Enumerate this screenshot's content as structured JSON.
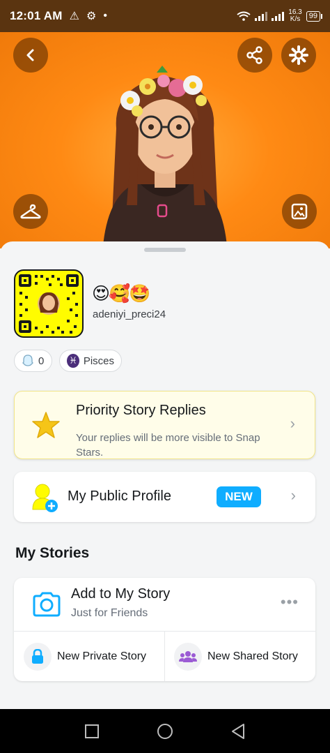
{
  "status_bar": {
    "time": "12:01 AM",
    "speed_value": "16.3",
    "speed_unit": "K/s",
    "battery": "99"
  },
  "hero": {
    "bg_color": "#ff8a14"
  },
  "profile": {
    "emojis": "😍🥰🤩",
    "username": "adeniyi_preci24",
    "friends_count": "0",
    "zodiac": "Pisces"
  },
  "priority_card": {
    "title": "Priority Story Replies",
    "subtitle": "Your replies will be more visible to Snap Stars."
  },
  "public_profile": {
    "title": "My Public Profile",
    "badge": "NEW"
  },
  "my_stories": {
    "section_title": "My Stories",
    "add_title": "Add to My Story",
    "add_subtitle": "Just for Friends",
    "private_label": "New Private Story",
    "shared_label": "New Shared Story"
  },
  "colors": {
    "snap_yellow": "#fffc00",
    "accent_blue": "#0fadff",
    "hero_orange": "#ff8a14"
  }
}
